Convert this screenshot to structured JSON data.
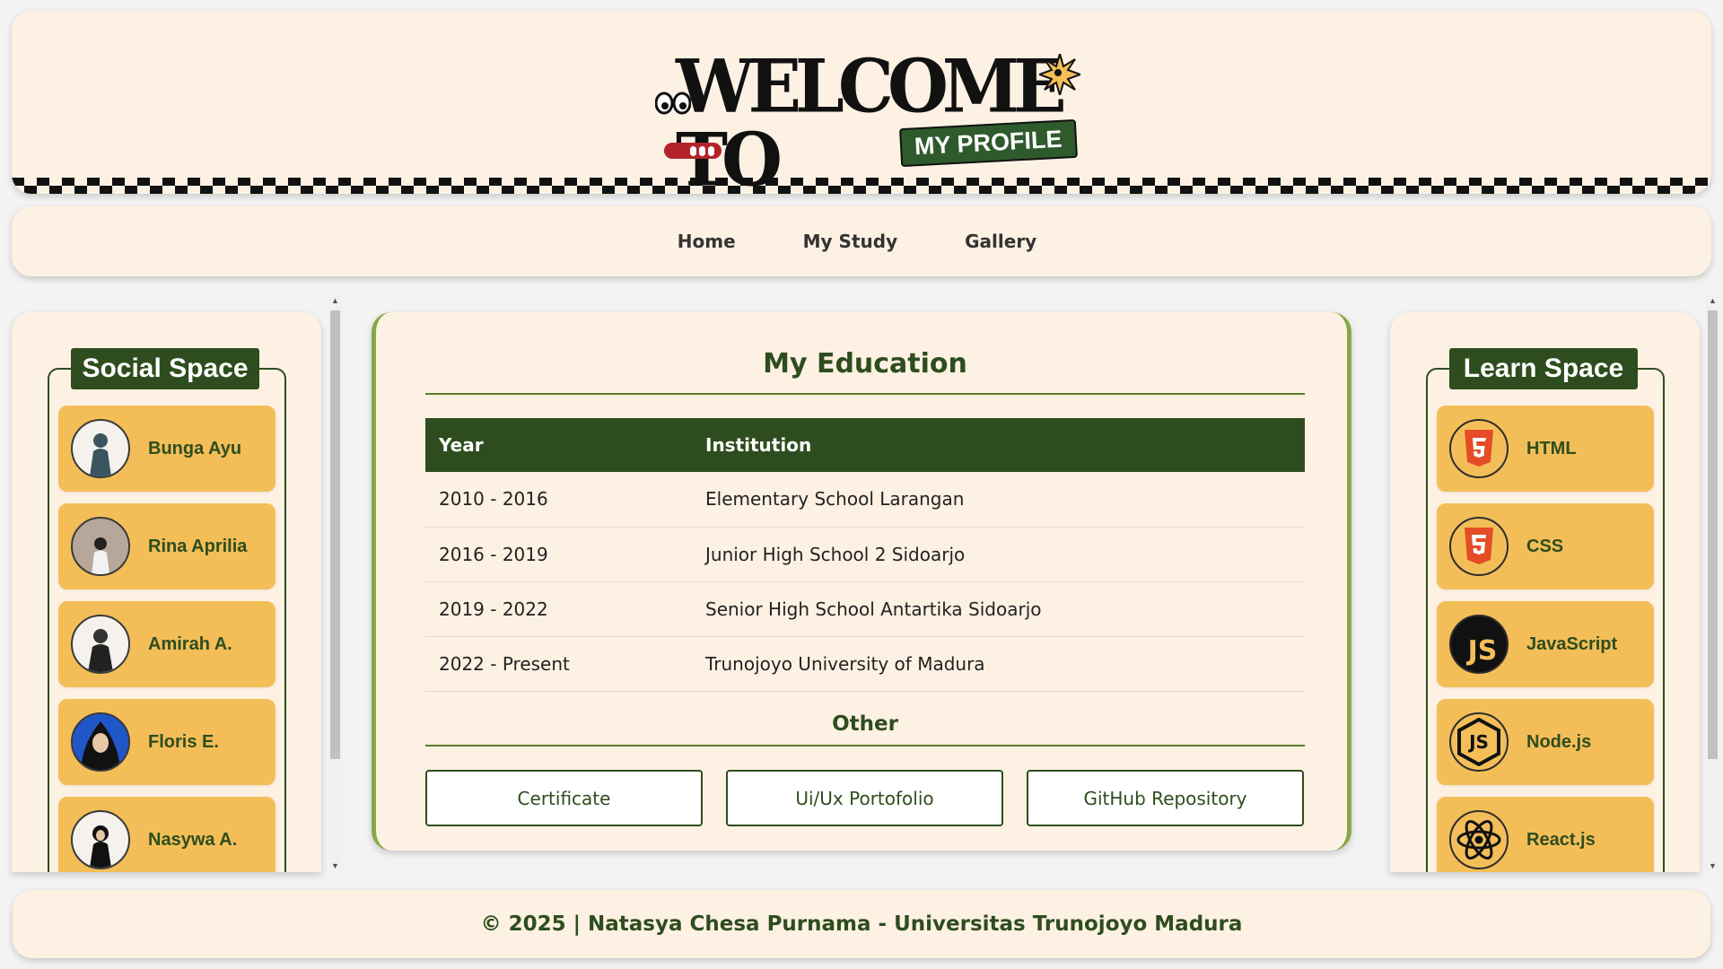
{
  "header": {
    "logo_title": "WELCOME TO",
    "logo_subtitle": "MY PROFILE"
  },
  "nav": {
    "items": [
      "Home",
      "My Study",
      "Gallery"
    ]
  },
  "social": {
    "title": "Social Space",
    "items": [
      "Bunga Ayu",
      "Rina Aprilia",
      "Amirah A.",
      "Floris E.",
      "Nasywa A."
    ]
  },
  "learn": {
    "title": "Learn Space",
    "items": [
      {
        "label": "HTML",
        "icon": "html5-icon"
      },
      {
        "label": "CSS",
        "icon": "css3-icon"
      },
      {
        "label": "JavaScript",
        "icon": "javascript-icon"
      },
      {
        "label": "Node.js",
        "icon": "nodejs-icon"
      },
      {
        "label": "React.js",
        "icon": "react-icon"
      }
    ]
  },
  "education": {
    "title": "My Education",
    "headers": [
      "Year",
      "Institution"
    ],
    "rows": [
      [
        "2010 - 2016",
        "Elementary School Larangan"
      ],
      [
        "2016 - 2019",
        "Junior High School 2 Sidoarjo"
      ],
      [
        "2019 - 2022",
        "Senior High School Antartika Sidoarjo"
      ],
      [
        "2022 - Present",
        "Trunojoyo University of Madura"
      ]
    ],
    "other_title": "Other",
    "buttons": [
      "Certificate",
      "Ui/Ux Portofolio",
      "GitHub Repository"
    ]
  },
  "footer": {
    "text": "© 2025 | Natasya Chesa Purnama - Universitas Trunojoyo Madura"
  },
  "colors": {
    "cream": "#fdf1e3",
    "dark_green": "#2e4d1e",
    "item_yellow": "#f3be58",
    "accent_green": "#86a843"
  }
}
